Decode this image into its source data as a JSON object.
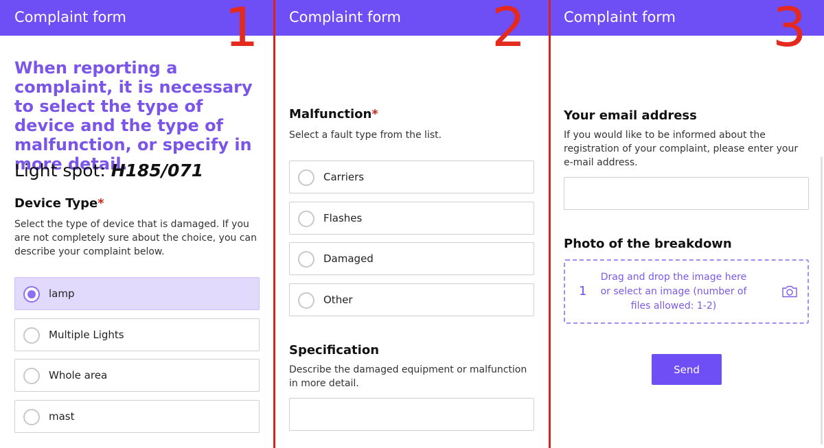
{
  "header": {
    "title": "Complaint form"
  },
  "steps": [
    "1",
    "2",
    "3"
  ],
  "panel1": {
    "intro": "When reporting a complaint, it is necessary to select the type of device and the type of malfunction, or specify in more detail.",
    "spot_label": "Light spot:",
    "spot_code": "H185/071",
    "device_type": {
      "title": "Device Type",
      "required_mark": "*",
      "description": "Select the type of device that is damaged. If you are not completely sure about the choice, you can describe your complaint below.",
      "options": [
        {
          "label": "lamp",
          "selected": true
        },
        {
          "label": "Multiple Lights",
          "selected": false
        },
        {
          "label": "Whole area",
          "selected": false
        },
        {
          "label": "mast",
          "selected": false
        }
      ]
    }
  },
  "panel2": {
    "malfunction": {
      "title": "Malfunction",
      "required_mark": "*",
      "description": "Select a fault type from the list.",
      "options": [
        {
          "label": "Carriers",
          "selected": false
        },
        {
          "label": "Flashes",
          "selected": false
        },
        {
          "label": "Damaged",
          "selected": false
        },
        {
          "label": "Other",
          "selected": false
        }
      ]
    },
    "specification": {
      "title": "Specification",
      "description": "Describe the damaged equipment or malfunction in more detail.",
      "value": ""
    }
  },
  "panel3": {
    "email": {
      "title": "Your email address",
      "description": "If you would like to be informed about the registration of your complaint, please enter your e-mail address.",
      "value": ""
    },
    "photo": {
      "title": "Photo of the breakdown",
      "count": "1",
      "dropzone_text": "Drag and drop the image here or select an image (number of files allowed: 1-2)",
      "icon": "camera-icon"
    },
    "send_label": "Send"
  },
  "colors": {
    "accent": "#6e4ff6",
    "selected_bg": "#e2dafc",
    "step_number": "#e42a1f",
    "divider": "#d9231b",
    "required": "#c22a1f"
  }
}
